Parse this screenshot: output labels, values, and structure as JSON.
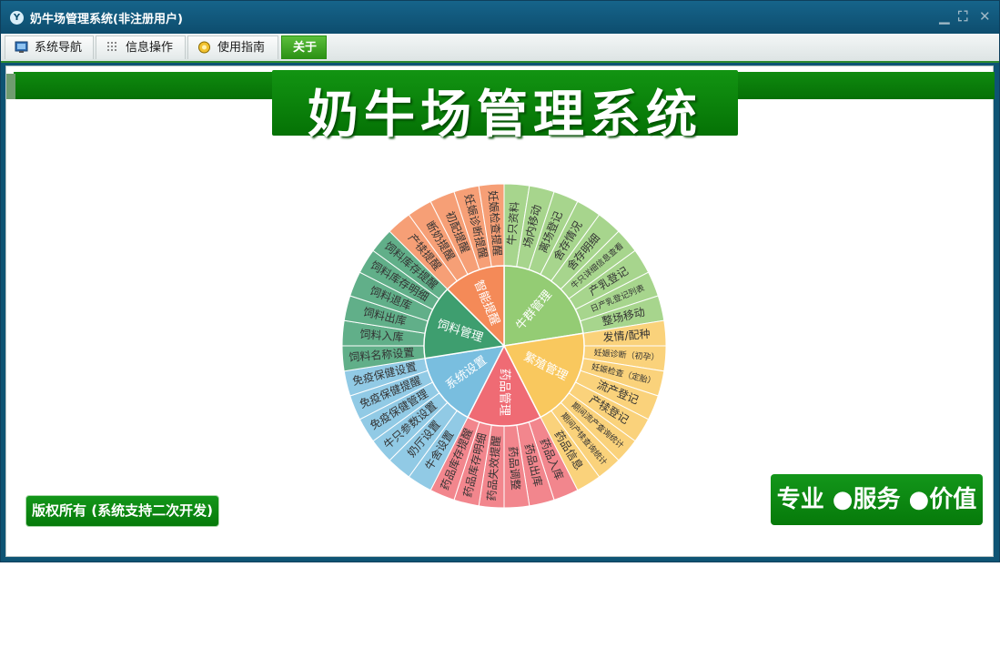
{
  "window": {
    "title": "奶牛场管理系统(非注册用户)"
  },
  "menu": {
    "tabs": [
      {
        "label": "系统导航"
      },
      {
        "label": "信息操作"
      },
      {
        "label": "使用指南"
      },
      {
        "label": "关于"
      }
    ]
  },
  "banner": {
    "title": "奶牛场管理系统"
  },
  "footer": {
    "copyright": "版权所有 (系统支持二次开发)",
    "slogan": "专业 ●服务 ●价值"
  },
  "colors": {
    "牛群管理": "#94cc74",
    "繁殖管理": "#f9c85e",
    "药品管理": "#ef6b74",
    "系统设置": "#79bedf",
    "饲料管理": "#3e9e6f",
    "智能提醒": "#f48a58"
  },
  "chart_data": {
    "type": "sunburst",
    "groups": [
      {
        "name": "牛群管理",
        "items": [
          "牛只资料",
          "场内移动",
          "离场登记",
          "舍存情况",
          "舍存明细",
          "牛只详细信息查看",
          "产乳登记",
          "日产乳登记列表",
          "整场移动"
        ]
      },
      {
        "name": "繁殖管理",
        "items": [
          "发情/配种",
          "妊娠诊断（初孕）",
          "妊娠检查（定胎）",
          "流产登记",
          "产犊登记",
          "期间流产查询统计",
          "期间产犊查询统计",
          "药品信息"
        ]
      },
      {
        "name": "药品管理",
        "items": [
          "药品入库",
          "药品出库",
          "药品调整",
          "药品失效提醒",
          "药品库存明细",
          "药品库存提醒"
        ]
      },
      {
        "name": "系统设置",
        "items": [
          "牛舍设置",
          "奶厅设置",
          "牛只参数设置",
          "免疫保健管理",
          "免疫保健提醒",
          "免疫保健设置"
        ]
      },
      {
        "name": "饲料管理",
        "items": [
          "饲料名称设置",
          "饲料入库",
          "饲料出库",
          "饲料退库",
          "饲料库存明细",
          "饲料库存提醒"
        ]
      },
      {
        "name": "智能提醒",
        "items": [
          "产犊提醒",
          "断奶提醒",
          "初配提醒",
          "妊娠诊断提醒",
          "妊娠检查提醒"
        ]
      }
    ]
  }
}
